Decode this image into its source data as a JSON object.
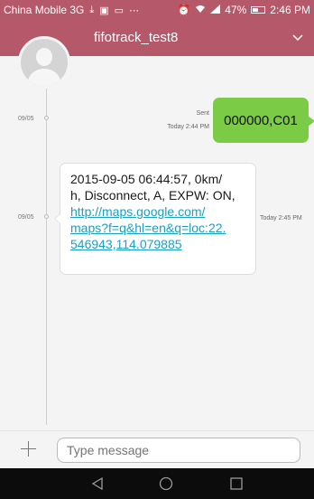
{
  "status_bar": {
    "carrier": "China Mobile 3G",
    "icons": [
      "download-icon",
      "image-icon",
      "screen-icon",
      "more-dots-icon",
      "alarm-icon",
      "wifi-icon",
      "signal-icon"
    ],
    "battery_percent": "47%",
    "time": "2:46 PM"
  },
  "header": {
    "contact_name": "fifotrack_test8"
  },
  "thread": {
    "messages": [
      {
        "direction": "sent",
        "date": "09/05",
        "status": "Sent",
        "time": "Today 2:44 PM",
        "text": "000000,C01"
      },
      {
        "direction": "received",
        "date": "09/05",
        "time": "Today 2:45 PM",
        "text_lines": [
          "2015-09-05 06:44:57, 0km/",
          "h, Disconnect, A, EXPW: ON,"
        ],
        "link_lines": [
          "http://maps.google.com/",
          "maps?f=q&hl=en&q=loc:22.",
          "546943,114.079885"
        ]
      }
    ]
  },
  "composer": {
    "placeholder": "Type message"
  },
  "colors": {
    "header": "#b5596a",
    "sent_bubble": "#7ccb46",
    "link": "#1aa0c4"
  }
}
